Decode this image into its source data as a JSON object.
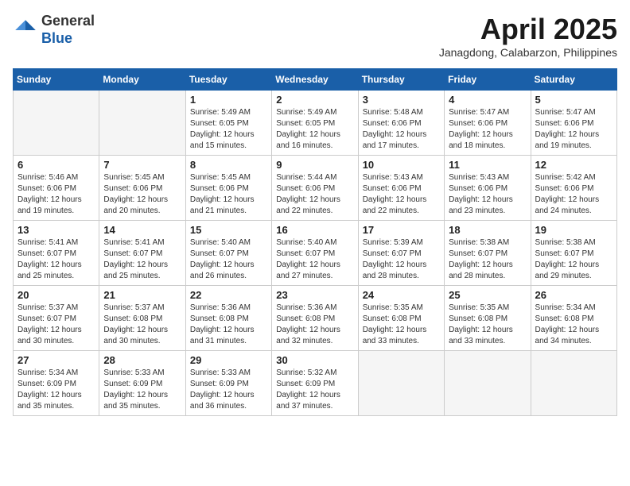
{
  "header": {
    "logo_general": "General",
    "logo_blue": "Blue",
    "title": "April 2025",
    "location": "Janagdong, Calabarzon, Philippines"
  },
  "days_of_week": [
    "Sunday",
    "Monday",
    "Tuesday",
    "Wednesday",
    "Thursday",
    "Friday",
    "Saturday"
  ],
  "weeks": [
    [
      {
        "day": "",
        "empty": true
      },
      {
        "day": "",
        "empty": true
      },
      {
        "day": "1",
        "sunrise": "5:49 AM",
        "sunset": "6:05 PM",
        "daylight": "12 hours and 15 minutes."
      },
      {
        "day": "2",
        "sunrise": "5:49 AM",
        "sunset": "6:05 PM",
        "daylight": "12 hours and 16 minutes."
      },
      {
        "day": "3",
        "sunrise": "5:48 AM",
        "sunset": "6:06 PM",
        "daylight": "12 hours and 17 minutes."
      },
      {
        "day": "4",
        "sunrise": "5:47 AM",
        "sunset": "6:06 PM",
        "daylight": "12 hours and 18 minutes."
      },
      {
        "day": "5",
        "sunrise": "5:47 AM",
        "sunset": "6:06 PM",
        "daylight": "12 hours and 19 minutes."
      }
    ],
    [
      {
        "day": "6",
        "sunrise": "5:46 AM",
        "sunset": "6:06 PM",
        "daylight": "12 hours and 19 minutes."
      },
      {
        "day": "7",
        "sunrise": "5:45 AM",
        "sunset": "6:06 PM",
        "daylight": "12 hours and 20 minutes."
      },
      {
        "day": "8",
        "sunrise": "5:45 AM",
        "sunset": "6:06 PM",
        "daylight": "12 hours and 21 minutes."
      },
      {
        "day": "9",
        "sunrise": "5:44 AM",
        "sunset": "6:06 PM",
        "daylight": "12 hours and 22 minutes."
      },
      {
        "day": "10",
        "sunrise": "5:43 AM",
        "sunset": "6:06 PM",
        "daylight": "12 hours and 22 minutes."
      },
      {
        "day": "11",
        "sunrise": "5:43 AM",
        "sunset": "6:06 PM",
        "daylight": "12 hours and 23 minutes."
      },
      {
        "day": "12",
        "sunrise": "5:42 AM",
        "sunset": "6:06 PM",
        "daylight": "12 hours and 24 minutes."
      }
    ],
    [
      {
        "day": "13",
        "sunrise": "5:41 AM",
        "sunset": "6:07 PM",
        "daylight": "12 hours and 25 minutes."
      },
      {
        "day": "14",
        "sunrise": "5:41 AM",
        "sunset": "6:07 PM",
        "daylight": "12 hours and 25 minutes."
      },
      {
        "day": "15",
        "sunrise": "5:40 AM",
        "sunset": "6:07 PM",
        "daylight": "12 hours and 26 minutes."
      },
      {
        "day": "16",
        "sunrise": "5:40 AM",
        "sunset": "6:07 PM",
        "daylight": "12 hours and 27 minutes."
      },
      {
        "day": "17",
        "sunrise": "5:39 AM",
        "sunset": "6:07 PM",
        "daylight": "12 hours and 28 minutes."
      },
      {
        "day": "18",
        "sunrise": "5:38 AM",
        "sunset": "6:07 PM",
        "daylight": "12 hours and 28 minutes."
      },
      {
        "day": "19",
        "sunrise": "5:38 AM",
        "sunset": "6:07 PM",
        "daylight": "12 hours and 29 minutes."
      }
    ],
    [
      {
        "day": "20",
        "sunrise": "5:37 AM",
        "sunset": "6:07 PM",
        "daylight": "12 hours and 30 minutes."
      },
      {
        "day": "21",
        "sunrise": "5:37 AM",
        "sunset": "6:08 PM",
        "daylight": "12 hours and 30 minutes."
      },
      {
        "day": "22",
        "sunrise": "5:36 AM",
        "sunset": "6:08 PM",
        "daylight": "12 hours and 31 minutes."
      },
      {
        "day": "23",
        "sunrise": "5:36 AM",
        "sunset": "6:08 PM",
        "daylight": "12 hours and 32 minutes."
      },
      {
        "day": "24",
        "sunrise": "5:35 AM",
        "sunset": "6:08 PM",
        "daylight": "12 hours and 33 minutes."
      },
      {
        "day": "25",
        "sunrise": "5:35 AM",
        "sunset": "6:08 PM",
        "daylight": "12 hours and 33 minutes."
      },
      {
        "day": "26",
        "sunrise": "5:34 AM",
        "sunset": "6:08 PM",
        "daylight": "12 hours and 34 minutes."
      }
    ],
    [
      {
        "day": "27",
        "sunrise": "5:34 AM",
        "sunset": "6:09 PM",
        "daylight": "12 hours and 35 minutes."
      },
      {
        "day": "28",
        "sunrise": "5:33 AM",
        "sunset": "6:09 PM",
        "daylight": "12 hours and 35 minutes."
      },
      {
        "day": "29",
        "sunrise": "5:33 AM",
        "sunset": "6:09 PM",
        "daylight": "12 hours and 36 minutes."
      },
      {
        "day": "30",
        "sunrise": "5:32 AM",
        "sunset": "6:09 PM",
        "daylight": "12 hours and 37 minutes."
      },
      {
        "day": "",
        "empty": true
      },
      {
        "day": "",
        "empty": true
      },
      {
        "day": "",
        "empty": true
      }
    ]
  ]
}
